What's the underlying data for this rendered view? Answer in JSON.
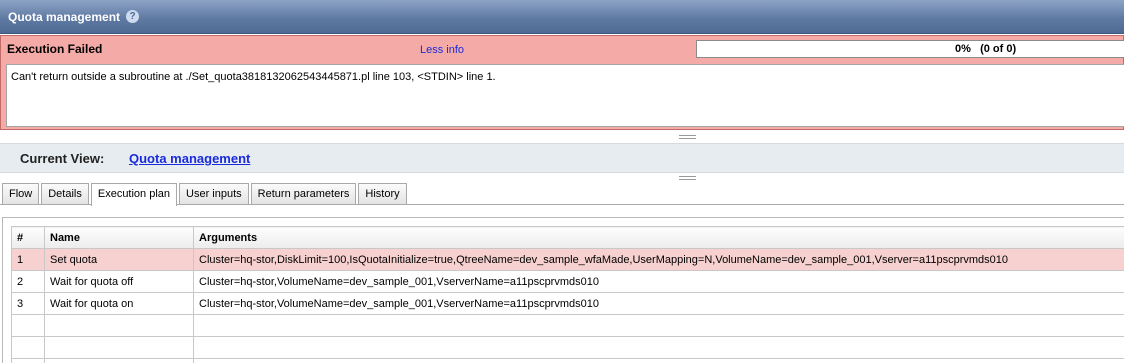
{
  "window": {
    "title": "Quota management",
    "help_glyph": "?"
  },
  "status": {
    "title": "Execution Failed",
    "less_info": "Less info",
    "progress_text": "0%   (0 of 0)",
    "progress_fraction": 0,
    "message": "Can't return outside a subroutine at ./Set_quota3818132062543445871.pl line 103, <STDIN> line 1."
  },
  "current_view": {
    "label": "Current View:",
    "link": "Quota management"
  },
  "tabs": [
    "Flow",
    "Details",
    "Execution plan",
    "User inputs",
    "Return parameters",
    "History"
  ],
  "active_tab": 2,
  "table": {
    "headers": [
      "#",
      "Name",
      "Arguments"
    ],
    "rows": [
      {
        "num": "1",
        "name": "Set quota",
        "args": "Cluster=hq-stor,DiskLimit=100,IsQuotaInitialize=true,QtreeName=dev_sample_wfaMade,UserMapping=N,VolumeName=dev_sample_001,Vserver=a11pscprvmds010",
        "status": "error"
      },
      {
        "num": "2",
        "name": "Wait for quota off",
        "args": "Cluster=hq-stor,VolumeName=dev_sample_001,VserverName=a11pscprvmds010",
        "status": ""
      },
      {
        "num": "3",
        "name": "Wait for quota on",
        "args": "Cluster=hq-stor,VolumeName=dev_sample_001,VserverName=a11pscprvmds010",
        "status": ""
      }
    ],
    "empty_rows": 3
  },
  "colors": {
    "error_bg": "#f4aaa6",
    "error_row": "#f6d1cf",
    "link": "#1a2bdb",
    "title_bar": "#5f7aa3"
  }
}
